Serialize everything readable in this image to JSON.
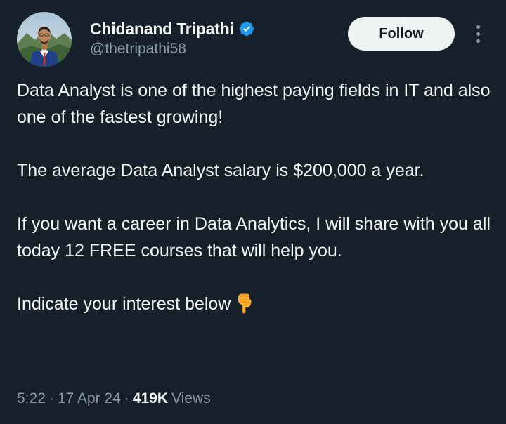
{
  "author": {
    "display_name": "Chidanand Tripathi",
    "handle": "@thetripathi58",
    "verified": true,
    "verified_icon": "verified-badge-icon"
  },
  "actions": {
    "follow_label": "Follow",
    "more_icon": "more-options-icon"
  },
  "tweet": {
    "paragraphs": [
      "Data Analyst is one of the highest paying fields in IT and also one of the fastest growing!",
      "The average Data Analyst salary is $200,000 a year.",
      "If you want a career in Data Analytics, I will share with you all today 12 FREE courses that will help you.",
      "Indicate your interest below"
    ],
    "emoji": "pointing-down-hand-emoji"
  },
  "meta": {
    "time": "5:22",
    "separator": "·",
    "date": "17 Apr 24",
    "views_count": "419K",
    "views_label": "Views"
  },
  "colors": {
    "background": "#15202b",
    "primary_text": "#f7f9f9",
    "secondary_text": "#8b98a5",
    "verified_blue": "#1d9bf0",
    "follow_button_bg": "#eff3f4"
  }
}
